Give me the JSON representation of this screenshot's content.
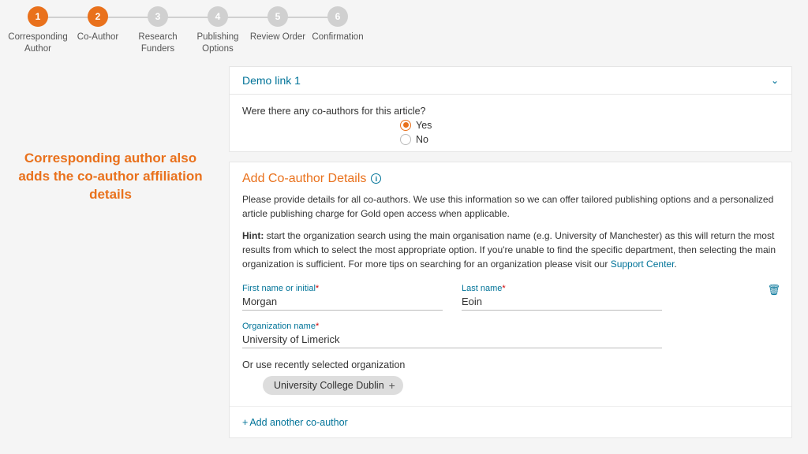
{
  "stepper": {
    "steps": [
      {
        "num": "1",
        "label": "Corresponding Author",
        "active": true
      },
      {
        "num": "2",
        "label": "Co-Author",
        "active": true
      },
      {
        "num": "3",
        "label": "Research Funders",
        "active": false
      },
      {
        "num": "4",
        "label": "Publishing Options",
        "active": false
      },
      {
        "num": "5",
        "label": "Review Order",
        "active": false
      },
      {
        "num": "6",
        "label": "Confirmation",
        "active": false
      }
    ]
  },
  "annotation": "Corresponding author also adds the co-author affiliation details",
  "accordion": {
    "title": "Demo link 1"
  },
  "question": {
    "text": "Were there any co-authors for this article?",
    "options": {
      "yes": "Yes",
      "no": "No"
    }
  },
  "section": {
    "title": "Add Co-author Details",
    "desc": "Please provide details for all co-authors. We use this information so we can offer tailored publishing options and a personalized article publishing charge for Gold open access when applicable.",
    "hint_label": "Hint:",
    "hint_text": " start the organization search using the main organisation name (e.g. University of Manchester) as this will return the most results from which to select the most appropriate option. If you're unable to find the specific department, then selecting the main organization is sufficient. For more tips on searching for an organization please visit our ",
    "hint_link": "Support Center",
    "hint_after": "."
  },
  "fields": {
    "first_label": "First name or initial",
    "first_value": "Morgan",
    "last_label": "Last name",
    "last_value": "Eoin",
    "org_label": "Organization name",
    "org_value": "University of Limerick"
  },
  "recent": {
    "label": "Or use recently selected organization",
    "chip": "University College Dublin"
  },
  "add_another": "Add another co-author"
}
